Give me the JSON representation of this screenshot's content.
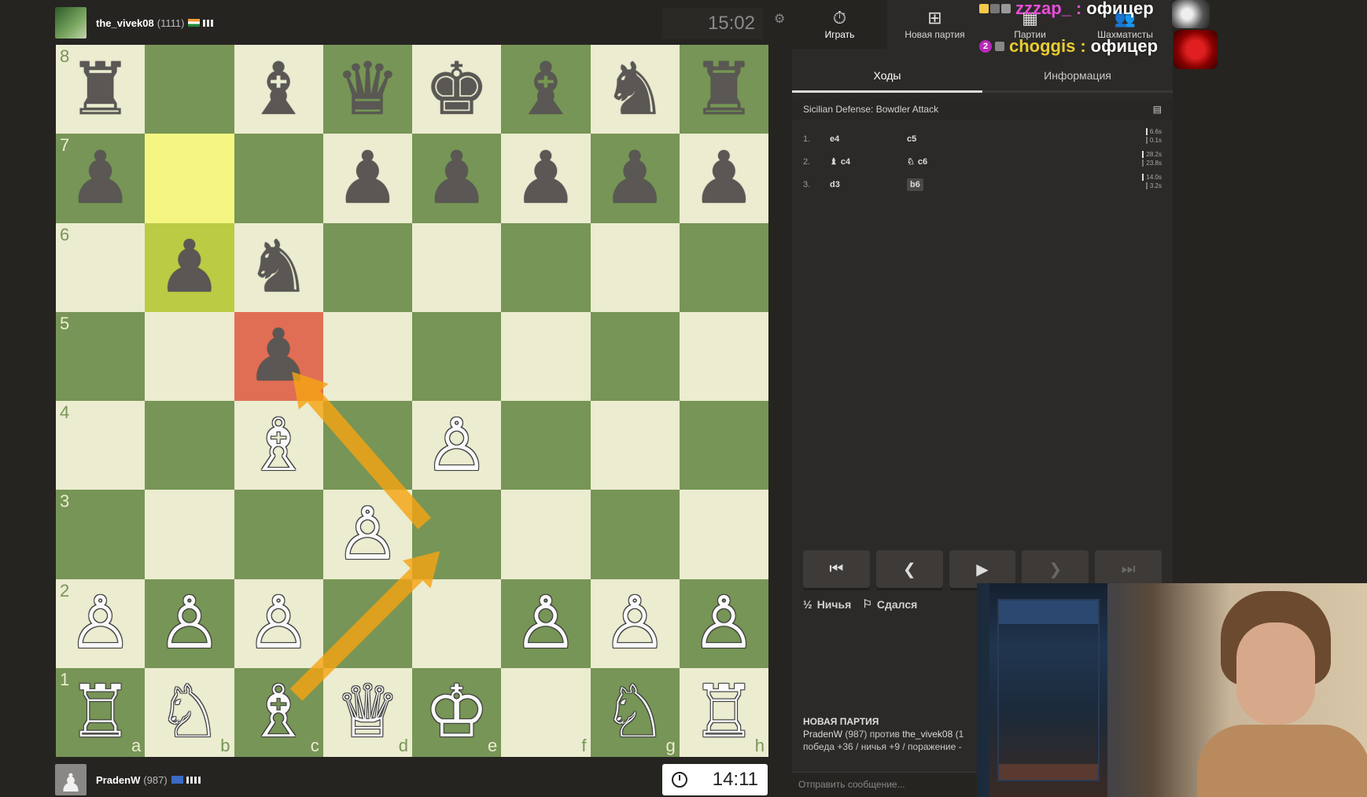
{
  "players": {
    "top": {
      "name": "the_vivek08",
      "rating": "(1111)"
    },
    "bottom": {
      "name": "PradenW",
      "rating": "(987)"
    }
  },
  "clocks": {
    "top": "15:02",
    "bottom": "14:11"
  },
  "board": {
    "ranks": [
      "8",
      "7",
      "6",
      "5",
      "4",
      "3",
      "2",
      "1"
    ],
    "files": [
      "a",
      "b",
      "c",
      "d",
      "e",
      "f",
      "g",
      "h"
    ],
    "rows": [
      [
        "♜",
        "",
        "♝",
        "♛",
        "♚",
        "♝",
        "♞",
        "♜"
      ],
      [
        "♟",
        "",
        "",
        "♟",
        "♟",
        "♟",
        "♟",
        "♟"
      ],
      [
        "",
        "♟",
        "♞",
        "",
        "",
        "",
        "",
        ""
      ],
      [
        "",
        "",
        "♟",
        "",
        "",
        "",
        "",
        ""
      ],
      [
        "",
        "",
        "♗",
        "",
        "♙",
        "",
        "",
        ""
      ],
      [
        "",
        "",
        "",
        "♙",
        "",
        "",
        "",
        ""
      ],
      [
        "♙",
        "♙",
        "♙",
        "",
        "",
        "♙",
        "♙",
        "♙"
      ],
      [
        "♖",
        "♘",
        "♗",
        "♕",
        "♔",
        "",
        "♘",
        "♖"
      ]
    ],
    "colors": [
      [
        "b",
        "",
        "b",
        "b",
        "b",
        "b",
        "b",
        "b"
      ],
      [
        "b",
        "",
        "",
        "b",
        "b",
        "b",
        "b",
        "b"
      ],
      [
        "",
        "b",
        "b",
        "",
        "",
        "",
        "",
        ""
      ],
      [
        "",
        "",
        "b",
        "",
        "",
        "",
        "",
        ""
      ],
      [
        "",
        "",
        "w",
        "",
        "w",
        "",
        "",
        ""
      ],
      [
        "",
        "",
        "",
        "w",
        "",
        "",
        "",
        ""
      ],
      [
        "w",
        "w",
        "w",
        "",
        "",
        "w",
        "w",
        "w"
      ],
      [
        "w",
        "w",
        "w",
        "w",
        "w",
        "",
        "w",
        "w"
      ]
    ],
    "highlight_from": "b7",
    "highlight_to": "b6",
    "highlight_red": "c5",
    "arrow_color": "#f4a414"
  },
  "nav": {
    "items": [
      {
        "label": "Играть",
        "icon": "stopwatch-icon",
        "glyph": "⏱"
      },
      {
        "label": "Новая партия",
        "icon": "plus-icon",
        "glyph": "⊞"
      },
      {
        "label": "Партии",
        "icon": "board-icon",
        "glyph": "▦"
      },
      {
        "label": "Шахматисты",
        "icon": "players-icon",
        "glyph": "👥"
      }
    ]
  },
  "tabs": {
    "moves": "Ходы",
    "info": "Информация"
  },
  "opening": "Sicilian Defense: Bowdler Attack",
  "moves": [
    {
      "no": "1.",
      "white": "e4",
      "black": "c5",
      "wt": "6.6s",
      "bt": "0.1s"
    },
    {
      "no": "2.",
      "white": "c4",
      "black": "c6",
      "wt": "28.2s",
      "bt": "23.8s"
    },
    {
      "no": "3.",
      "white": "d3",
      "black": "b6",
      "wt": "14.0s",
      "bt": "3.2s"
    }
  ],
  "actions": {
    "draw": "Ничья",
    "resign": "Сдался",
    "draw_glyph": "½"
  },
  "newgame": {
    "title": "НОВАЯ ПАРТИЯ",
    "player1": "PradenW",
    "rating1": "(987)",
    "vs": "против",
    "player2": "the_vivek08",
    "rating2": "(1",
    "stats": "победа +36 / ничья +9 / поражение -"
  },
  "chat_placeholder": "Отправить сообщение...",
  "overlay": {
    "line1_user": "zzzap_",
    "line1_sep": ":",
    "line1_msg": "офицер",
    "line2_badge": "2",
    "line2_user": "choggis",
    "line2_sep": ":",
    "line2_msg": "офицер"
  }
}
